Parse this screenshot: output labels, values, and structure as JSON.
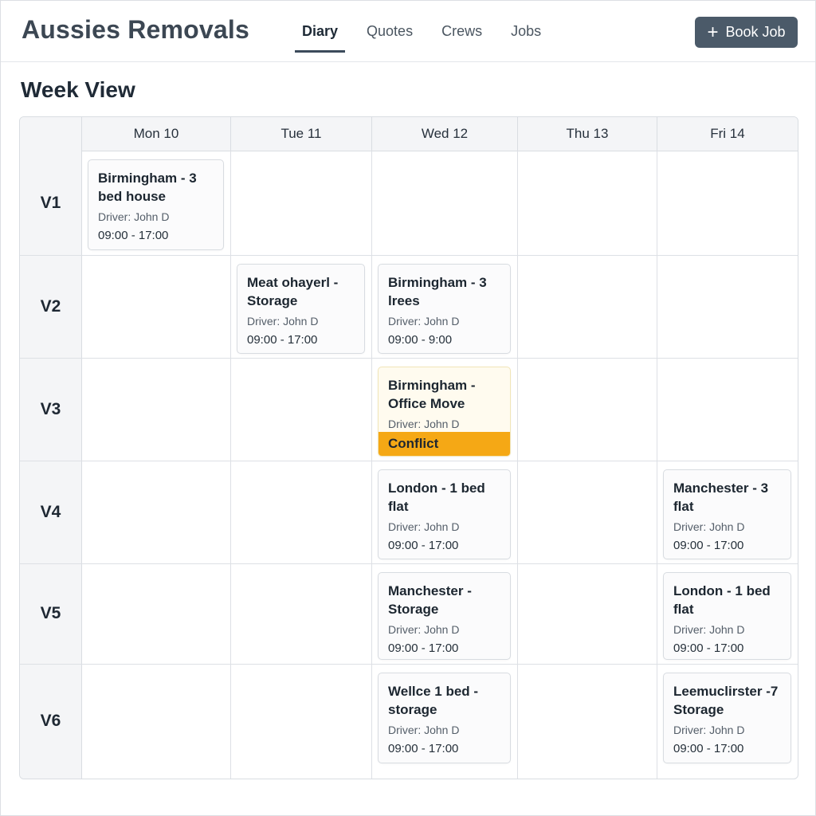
{
  "app": {
    "title": "Aussies Removals"
  },
  "nav": {
    "items": [
      {
        "label": "Diary",
        "active": true
      },
      {
        "label": "Quotes",
        "active": false
      },
      {
        "label": "Crews",
        "active": false
      },
      {
        "label": "Jobs",
        "active": false
      }
    ]
  },
  "toolbar": {
    "book_label": "Book Job",
    "book_icon": "plus-icon"
  },
  "page": {
    "title": "Week View"
  },
  "week": {
    "days": [
      "Mon 10",
      "Tue 11",
      "Wed 12",
      "Thu 13",
      "Fri 14"
    ],
    "vehicles": [
      "V1",
      "V2",
      "V3",
      "V4",
      "V5",
      "V6"
    ]
  },
  "jobs": [
    {
      "vehicle": "V1",
      "day": "Mon 10",
      "title": "Birmingham - 3 bed house",
      "driver": "Driver: John D",
      "time": "09:00 - 17:00"
    },
    {
      "vehicle": "V2",
      "day": "Tue 11",
      "title": "Meat ohayerl - Storage",
      "driver": "Driver: John D",
      "time": "09:00 - 17:00"
    },
    {
      "vehicle": "V2",
      "day": "Wed 12",
      "title": "Birmingham - 3 lrees",
      "driver": "Driver: John D",
      "time": "09:00 - 9:00"
    },
    {
      "vehicle": "V3",
      "day": "Wed 12",
      "title": "Birmingham - Office Move",
      "driver": "Driver: John D",
      "status": "Conflict"
    },
    {
      "vehicle": "V4",
      "day": "Wed 12",
      "title": "London - 1 bed flat",
      "driver": "Driver: John D",
      "time": "09:00 - 17:00"
    },
    {
      "vehicle": "V4",
      "day": "Fri 14",
      "title": "Manchester - 3 flat",
      "driver": "Driver: John D",
      "time": "09:00 - 17:00"
    },
    {
      "vehicle": "V5",
      "day": "Wed 12",
      "title": "Manchester - Storage",
      "driver": "Driver: John D",
      "time": "09:00 - 17:00"
    },
    {
      "vehicle": "V5",
      "day": "Fri 14",
      "title": "London - 1 bed flat",
      "driver": "Driver: John D",
      "time": "09:00 - 17:00"
    },
    {
      "vehicle": "V6",
      "day": "Wed 12",
      "title": "Wellce 1 bed - storage",
      "driver": "Driver: John D",
      "time": "09:00 - 17:00"
    },
    {
      "vehicle": "V6",
      "day": "Fri 14",
      "title": "Leemuclirster -7 Storage",
      "driver": "Driver: John D",
      "time": "09:00 - 17:00"
    }
  ],
  "colors": {
    "accent": "#4b5a69",
    "conflict": "#f5a815",
    "brand_text": "#3c4753"
  }
}
